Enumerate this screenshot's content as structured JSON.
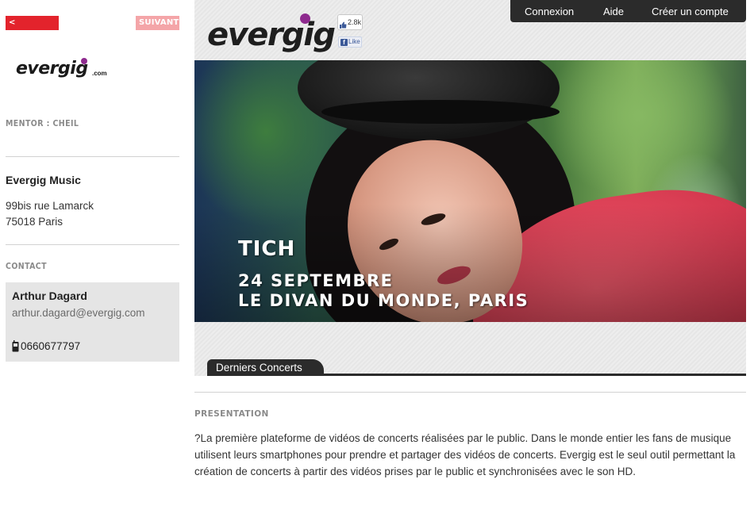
{
  "nav": {
    "prev_label": "< PRÉCÉDENT",
    "next_label": "SUIVANT >"
  },
  "sidebar": {
    "logo_text": "evergig",
    "logo_suffix": ".com",
    "mentor_label": "MENTOR : CHEIL",
    "company_name": "Evergig Music",
    "address_line1": "99bis rue Lamarck",
    "address_line2": "75018 Paris",
    "contact_label": "CONTACT",
    "contact": {
      "name": "Arthur Dagard",
      "email": "arthur.dagard@evergig.com",
      "phone": "0660677797"
    }
  },
  "header": {
    "logo_text": "evergig",
    "like_count": "2.8k",
    "fb_like_label": "Like",
    "menu": {
      "connexion": "Connexion",
      "aide": "Aide",
      "creer_compte": "Créer un compte"
    }
  },
  "hero": {
    "artist": "TICH",
    "date": "24 SEPTEMBRE",
    "venue": "LE DIVAN DU MONDE, PARIS"
  },
  "tabs": {
    "active": "Derniers Concerts"
  },
  "presentation": {
    "label": "PRESENTATION",
    "text": "?La première plateforme de vidéos de concerts réalisées par le public. Dans le monde entier les fans de musique utilisent leurs smartphones pour prendre et partager des vidéos de concerts. Evergig est le seul outil permettant la création de concerts à partir des vidéos prises par le public et synchronisées avec le son HD."
  },
  "colors": {
    "prev_button": "#e3232c",
    "next_button": "#f4a5a8",
    "logo_dot": "#8e2a8e",
    "menu_bar": "#2b2b2b",
    "contact_box": "#e5e5e5"
  },
  "icons": [
    "thumbs-up-icon",
    "facebook-icon",
    "phone-icon"
  ]
}
